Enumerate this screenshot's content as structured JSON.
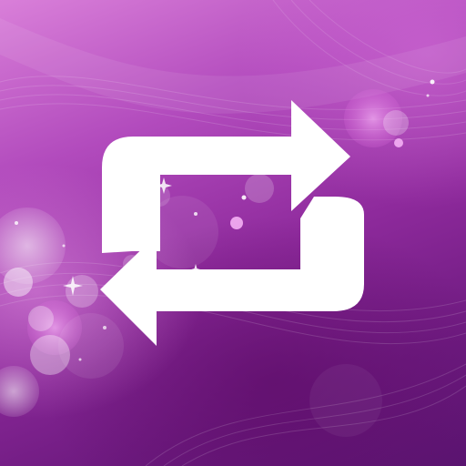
{
  "icon": {
    "name": "repeat-icon",
    "symbol_color": "#ffffff"
  },
  "background": {
    "colors": [
      "#d97fd9",
      "#b24bbd",
      "#8e2a9c",
      "#6d1a7f",
      "#5a1470"
    ]
  }
}
